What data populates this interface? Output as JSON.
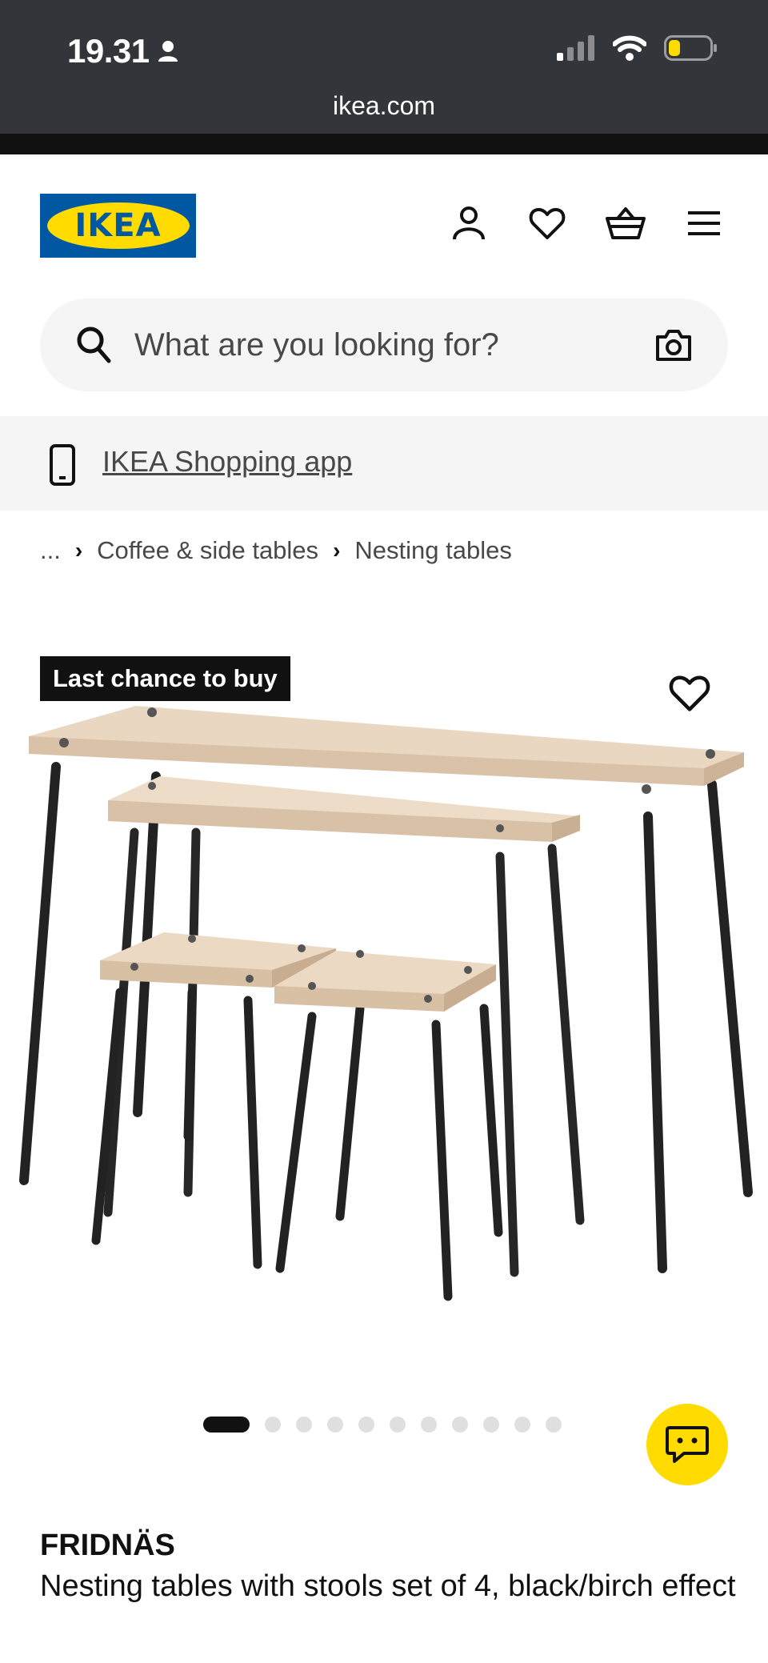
{
  "status_bar": {
    "time": "19.31",
    "url": "ikea.com"
  },
  "header": {
    "logo_text": "IKEA",
    "icons": [
      "profile-icon",
      "heart-icon",
      "basket-icon",
      "menu-icon"
    ]
  },
  "search": {
    "placeholder": "What are you looking for?"
  },
  "app_banner": {
    "label": "IKEA Shopping app"
  },
  "breadcrumb": {
    "items": [
      "...",
      "Coffee & side tables",
      "Nesting tables"
    ]
  },
  "product": {
    "badge": "Last chance to buy",
    "name": "FRIDNÄS",
    "description": "Nesting tables with stools set of 4, black/birch effect",
    "image_count": 12,
    "active_image": 1
  },
  "colors": {
    "ikea_blue": "#0058a3",
    "ikea_yellow": "#ffdb00",
    "status_bar": "#32363a"
  }
}
